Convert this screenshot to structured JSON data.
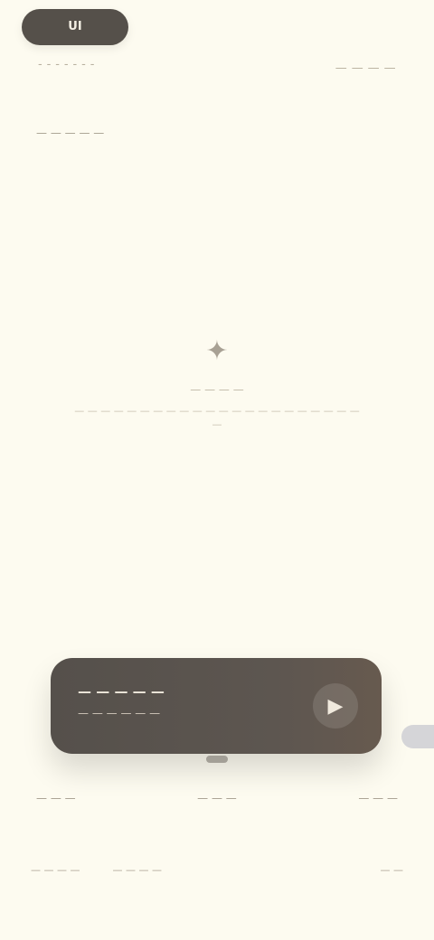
{
  "top_pill": {
    "label": "UI"
  },
  "header": {
    "left_meta": "- - - - - - -",
    "right_meta": "— — — —"
  },
  "section": {
    "label": "— — — — —"
  },
  "empty_state": {
    "icon_name": "sparkle-icon",
    "title": "— — — —",
    "description": "— — — — — — — — — — — — — — — — — — — — — — —"
  },
  "player": {
    "title": "— — — — —",
    "subtitle": "— — — — — —",
    "play_icon": "play-icon",
    "button_label": "▶"
  },
  "tabs": [
    "— — —",
    "— — —",
    "— — —"
  ],
  "footer": {
    "left_1": "— — — —",
    "left_2": "— — — —",
    "right": "— —"
  },
  "colors": {
    "background": "#fdfbf0",
    "accent_dark": "#55504a"
  }
}
